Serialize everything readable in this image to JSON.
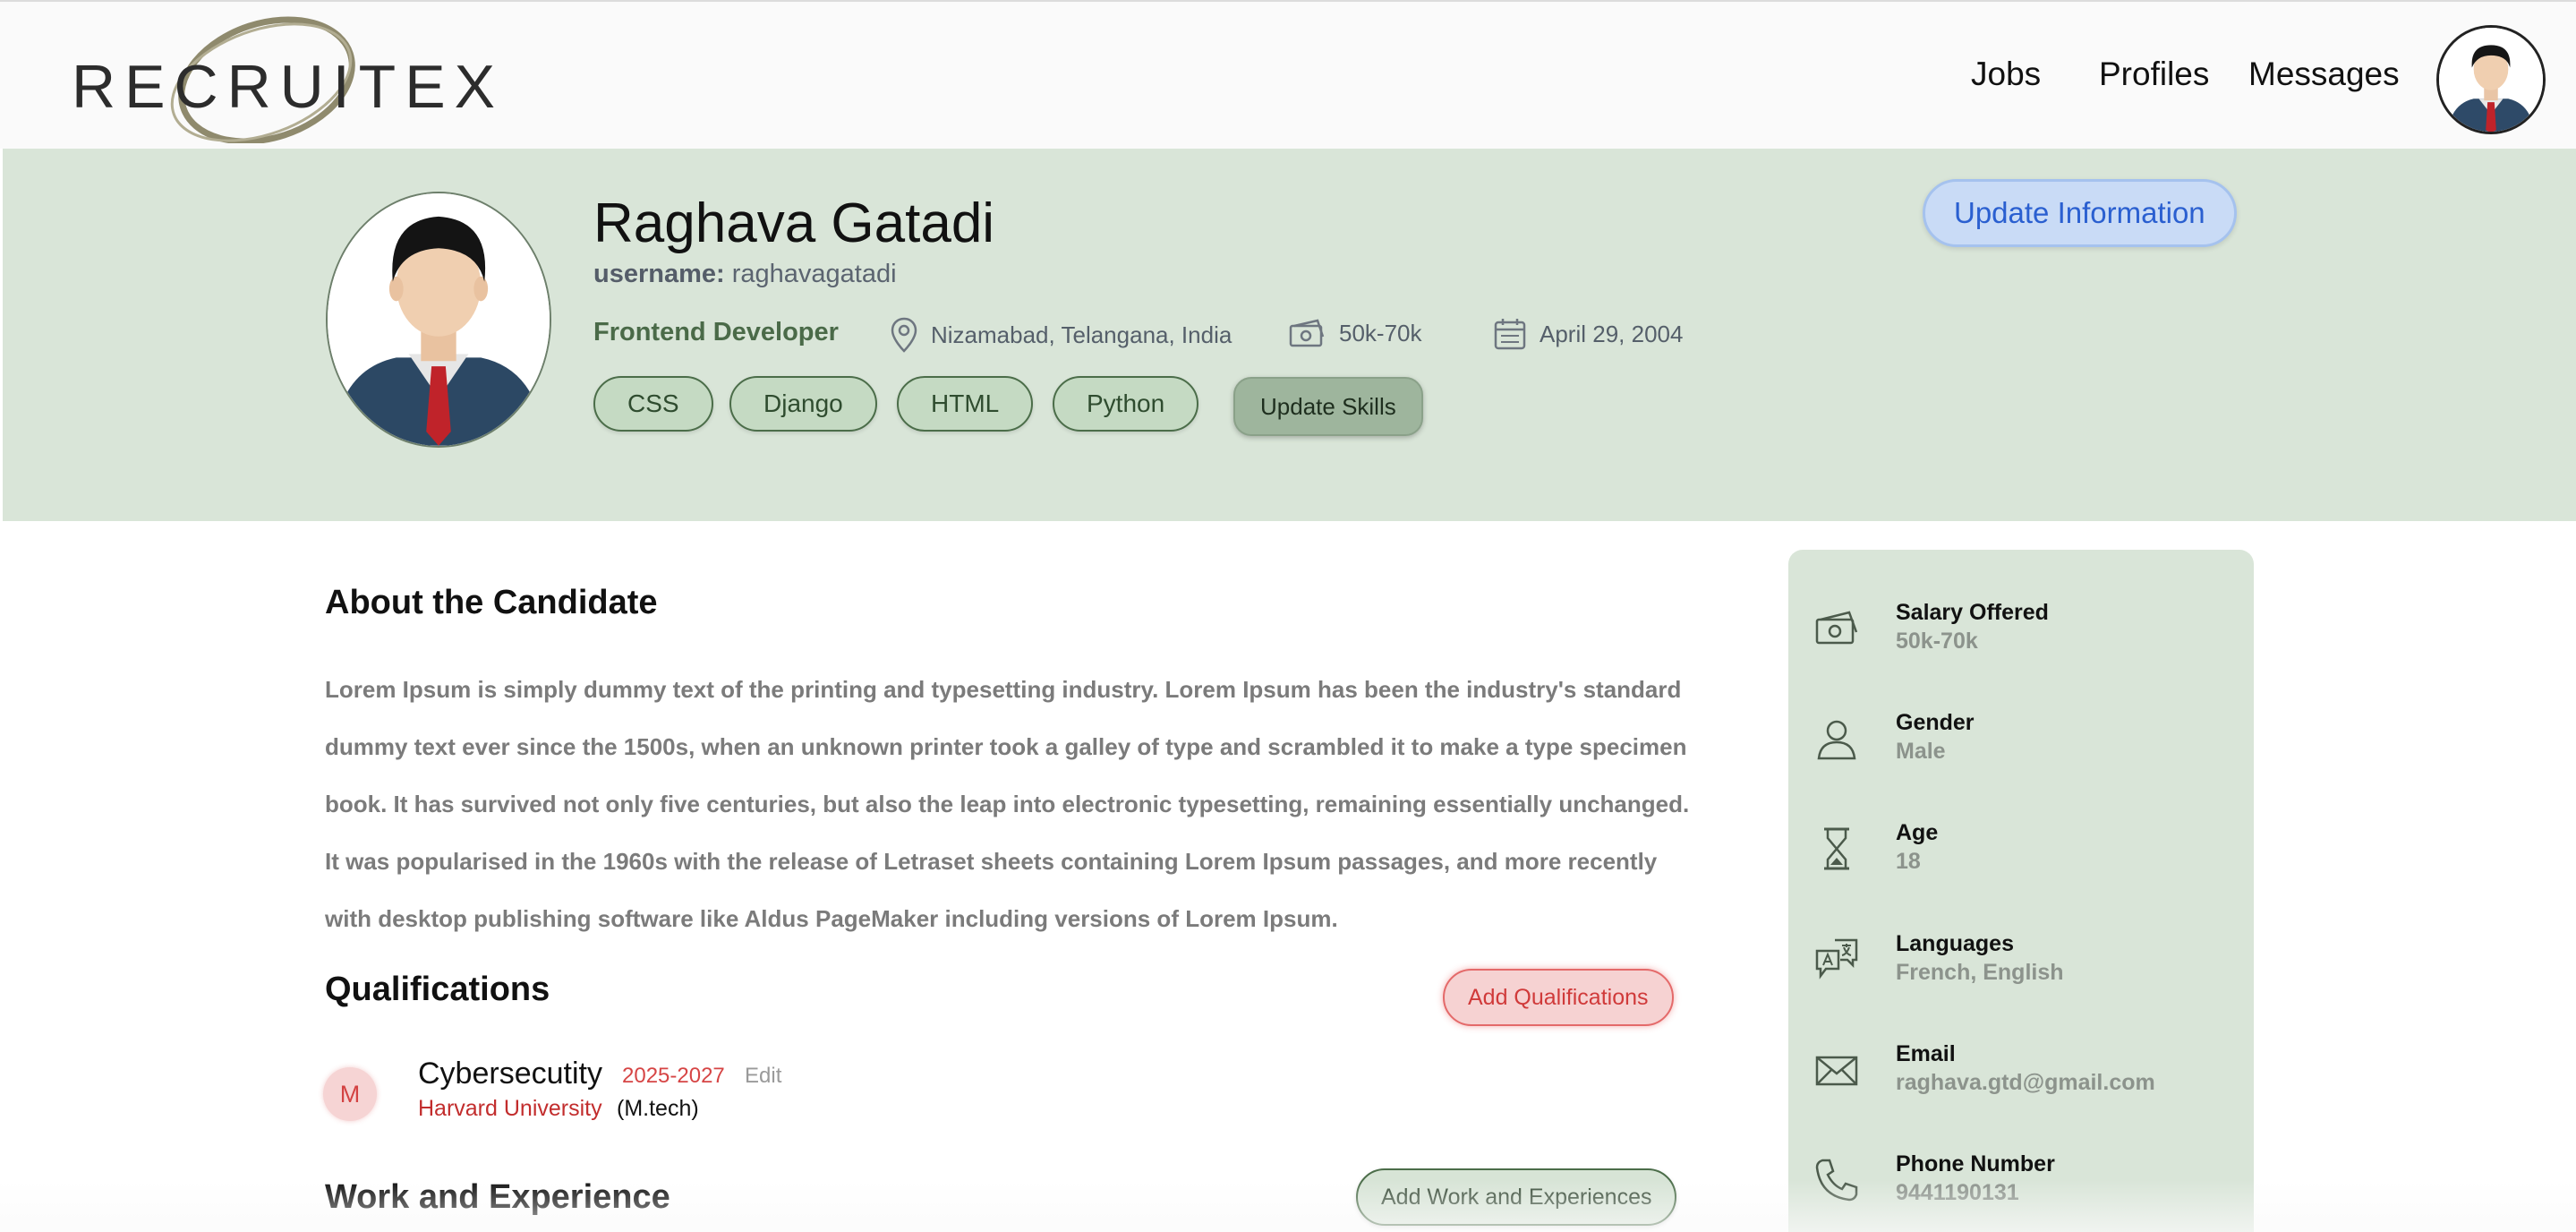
{
  "nav": {
    "logo_text": "RECRUITEX",
    "links": [
      "Jobs",
      "Profiles",
      "Messages"
    ]
  },
  "profile": {
    "name": "Raghava Gatadi",
    "username_label": "username:",
    "username": "raghavagatadi",
    "role": "Frontend Developer",
    "location": "Nizamabad, Telangana, India",
    "salary": "50k-70k",
    "dob": "April 29, 2004",
    "skills": [
      "CSS",
      "Django",
      "HTML",
      "Python"
    ],
    "update_skills_label": "Update Skills",
    "update_info_label": "Update Information"
  },
  "about": {
    "heading": "About the Candidate",
    "text": "Lorem Ipsum is simply dummy text of the printing and typesetting industry. Lorem Ipsum has been the industry's standard dummy text ever since the 1500s, when an unknown printer took a galley of type and scrambled it to make a type specimen book. It has survived not only five centuries, but also the leap into electronic typesetting, remaining essentially unchanged. It was popularised in the 1960s with the release of Letraset sheets containing Lorem Ipsum passages, and more recently with desktop publishing software like Aldus PageMaker including versions of Lorem Ipsum."
  },
  "qualifications": {
    "heading": "Qualifications",
    "add_label": "Add Qualifications",
    "items": [
      {
        "badge": "M",
        "title": "Cybersecutity",
        "years": "2025-2027",
        "edit_label": "Edit",
        "university": "Harvard University",
        "degree": "(M.tech)"
      }
    ]
  },
  "work": {
    "heading": "Work and Experience",
    "add_label": "Add Work and Experiences"
  },
  "sidebar": {
    "items": [
      {
        "icon": "money-icon",
        "label": "Salary Offered",
        "value": "50k-70k"
      },
      {
        "icon": "user-icon",
        "label": "Gender",
        "value": "Male"
      },
      {
        "icon": "hourglass-icon",
        "label": "Age",
        "value": "18"
      },
      {
        "icon": "translate-icon",
        "label": "Languages",
        "value": "French, English"
      },
      {
        "icon": "envelope-icon",
        "label": "Email",
        "value": "raghava.gtd@gmail.com"
      },
      {
        "icon": "phone-icon",
        "label": "Phone Number",
        "value": "9441190131"
      }
    ]
  },
  "colors": {
    "hero_bg": "#d9e5d8",
    "accent_green": "#4b6d49",
    "accent_red": "#d03a3a",
    "accent_blue": "#2a5fd0"
  }
}
